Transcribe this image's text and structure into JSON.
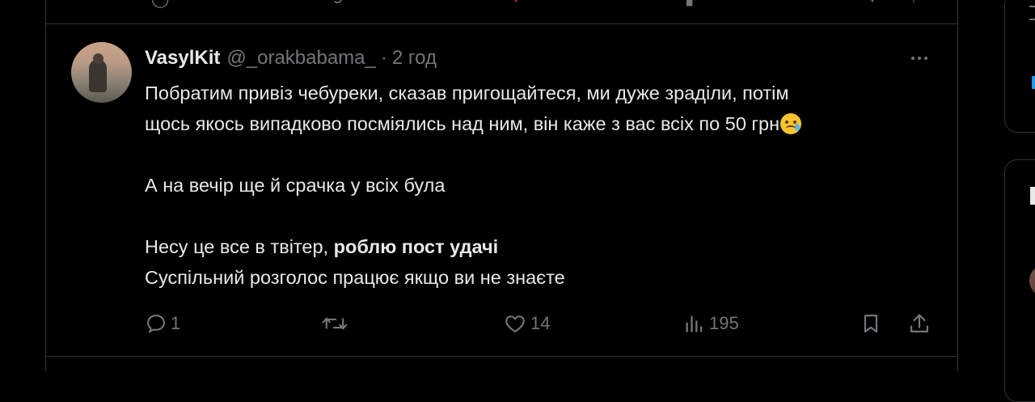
{
  "tweet": {
    "display_name": "VasylKit",
    "handle": "@_orakbabama_",
    "separator": "·",
    "time": "2 год",
    "lines": [
      "Побратим привіз чебуреки, сказав пригощайтеся, ми дуже зраділи, потім",
      "щось якось випадково посміялись над ним, він каже з вас всіх по 50 грн"
    ],
    "emoji": "face-holding-back-tears",
    "line3": "А на вечір ще й срачка у всіх була",
    "line4_regular": "Несу це все в твітер, ",
    "line4_bold": "роблю пост удачі",
    "line5": "Суспільний розголос працює якщо ви не знаєте"
  },
  "actions": {
    "reply_count": "1",
    "repost_count": "",
    "like_count": "14",
    "views_count": "195"
  },
  "colors": {
    "background": "#000000",
    "text": "#e7e9ea",
    "secondary": "#71767b",
    "border": "#2f3336",
    "accent": "#1d9bf0"
  }
}
